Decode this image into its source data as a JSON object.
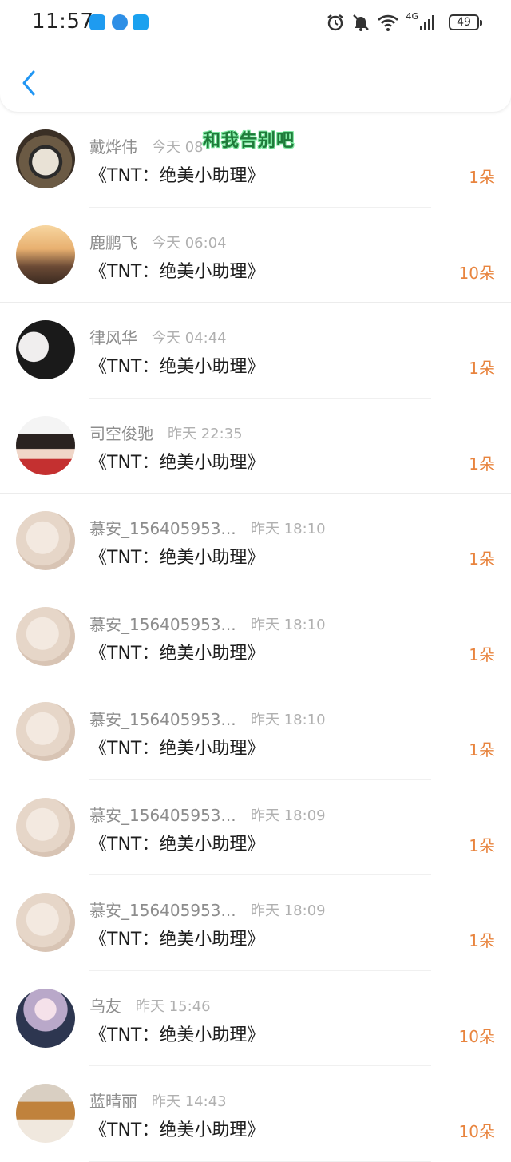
{
  "status_bar": {
    "time": "11:57",
    "network_label": "4G",
    "battery_level": "49"
  },
  "colors": {
    "accent": "#2196F3",
    "gift_count": "#E8843E",
    "name_text": "#8D8D8D",
    "time_text": "#B0B0B0"
  },
  "overlay_caption": "和我告别吧",
  "records": [
    {
      "name": "戴烨伟",
      "time": "今天 08",
      "book": "《TNT：绝美小助理》",
      "gift": "1朵",
      "avatar": "clock"
    },
    {
      "name": "鹿鹏飞",
      "time": "今天 06:04",
      "book": "《TNT：绝美小助理》",
      "gift": "10朵",
      "avatar": "sunset"
    },
    {
      "name": "律风华",
      "time": "今天 04:44",
      "book": "《TNT：绝美小助理》",
      "gift": "1朵",
      "avatar": "girl"
    },
    {
      "name": "司空俊驰",
      "time": "昨天 22:35",
      "book": "《TNT：绝美小助理》",
      "gift": "1朵",
      "avatar": "boy"
    },
    {
      "name": "慕安_156405953...",
      "time": "昨天 18:10",
      "book": "《TNT：绝美小助理》",
      "gift": "1朵",
      "avatar": "blur"
    },
    {
      "name": "慕安_156405953...",
      "time": "昨天 18:10",
      "book": "《TNT：绝美小助理》",
      "gift": "1朵",
      "avatar": "blur"
    },
    {
      "name": "慕安_156405953...",
      "time": "昨天 18:10",
      "book": "《TNT：绝美小助理》",
      "gift": "1朵",
      "avatar": "blur"
    },
    {
      "name": "慕安_156405953...",
      "time": "昨天 18:09",
      "book": "《TNT：绝美小助理》",
      "gift": "1朵",
      "avatar": "blur"
    },
    {
      "name": "慕安_156405953...",
      "time": "昨天 18:09",
      "book": "《TNT：绝美小助理》",
      "gift": "1朵",
      "avatar": "blur"
    },
    {
      "name": "乌友",
      "time": "昨天 15:46",
      "book": "《TNT：绝美小助理》",
      "gift": "10朵",
      "avatar": "anime"
    },
    {
      "name": "蓝晴丽",
      "time": "昨天 14:43",
      "book": "《TNT：绝美小助理》",
      "gift": "10朵",
      "avatar": "tree"
    }
  ]
}
